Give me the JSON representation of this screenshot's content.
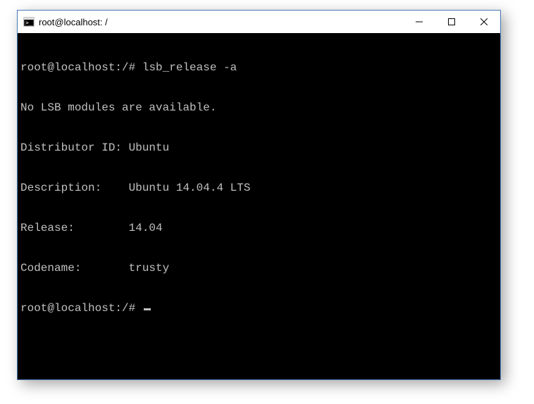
{
  "window": {
    "title": "root@localhost: /"
  },
  "terminal": {
    "prompt": "root@localhost:/#",
    "command": "lsb_release -a",
    "lines": {
      "no_lsb": "No LSB modules are available.",
      "distributor": "Distributor ID: Ubuntu",
      "description": "Description:    Ubuntu 14.04.4 LTS",
      "release": "Release:        14.04",
      "codename": "Codename:       trusty"
    }
  }
}
